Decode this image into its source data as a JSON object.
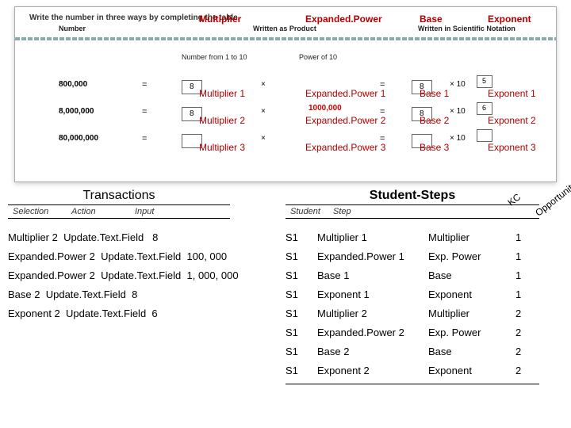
{
  "worksheet": {
    "instruction": "Write the number in three ways by completing the table.",
    "columns": {
      "number": "Number",
      "product": "Written as Product",
      "scientific": "Written in Scientific Notation"
    },
    "sub": {
      "range": "Number from 1 to 10",
      "power": "Power of 10"
    },
    "overlay_top": {
      "multiplier": "Multiplier",
      "expanded": "Expanded.Power",
      "base": "Base",
      "exponent": "Exponent"
    },
    "rows": [
      {
        "num": "800,000",
        "mult_val": "8",
        "mult_label": "Multiplier 1",
        "exp_label": "Expanded.Power 1",
        "base_val": "8",
        "base_label": "Base 1",
        "exp_small": "5",
        "exponent_label": "Exponent 1"
      },
      {
        "num": "8,000,000",
        "mult_val": "8",
        "mult_label": "Multiplier 2",
        "red": "1000,000",
        "exp_label": "Expanded.Power 2",
        "base_val": "8",
        "base_label": "Base 2",
        "exp_small": "6",
        "exponent_label": "Exponent 2"
      },
      {
        "num": "80,000,000",
        "mult_val": "",
        "mult_label": "Multiplier 3",
        "exp_label": "Expanded.Power 3",
        "base_val": "",
        "base_label": "Base 3",
        "exp_small": "",
        "exponent_label": "Exponent 3"
      }
    ],
    "times10": "× 10"
  },
  "transactions": {
    "title": "Transactions",
    "head": {
      "selection": "Selection",
      "action": "Action",
      "input": "Input"
    },
    "lines": [
      {
        "sel": "Multiplier 2",
        "act": "Update.Text.Field",
        "inp": "8"
      },
      {
        "sel": "Expanded.Power 2",
        "act": "Update.Text.Field",
        "inp": "100, 000"
      },
      {
        "sel": "Expanded.Power 2",
        "act": "Update.Text.Field",
        "inp": "1, 000, 000"
      },
      {
        "sel": "Base 2",
        "act": "Update.Text.Field",
        "inp": "8"
      },
      {
        "sel": "Exponent 2",
        "act": "Update.Text.Field",
        "inp": "6"
      }
    ]
  },
  "studentsteps": {
    "title": "Student-Steps",
    "head": {
      "student": "Student",
      "step": "Step"
    },
    "kc": "KC",
    "opp": "Opportunity",
    "rows": [
      {
        "stu": "S1",
        "step": "Multiplier 1",
        "kc": "Multiplier",
        "opp": "1"
      },
      {
        "stu": "S1",
        "step": "Expanded.Power 1",
        "kc": " Exp. Power",
        "opp": "1"
      },
      {
        "stu": "S1",
        "step": "Base 1",
        "kc": "Base",
        "opp": "1"
      },
      {
        "stu": "S1",
        "step": "Exponent 1",
        "kc": "Exponent",
        "opp": "1"
      },
      {
        "stu": "S1",
        "step": "Multiplier 2",
        "kc": "Multiplier",
        "opp": "2"
      },
      {
        "stu": "S1",
        "step": "Expanded.Power 2",
        "kc": " Exp. Power",
        "opp": "2"
      },
      {
        "stu": "S1",
        "step": "Base 2",
        "kc": "Base",
        "opp": "2"
      },
      {
        "stu": "S1",
        "step": "Exponent 2",
        "kc": "Exponent",
        "opp": "2"
      }
    ]
  }
}
